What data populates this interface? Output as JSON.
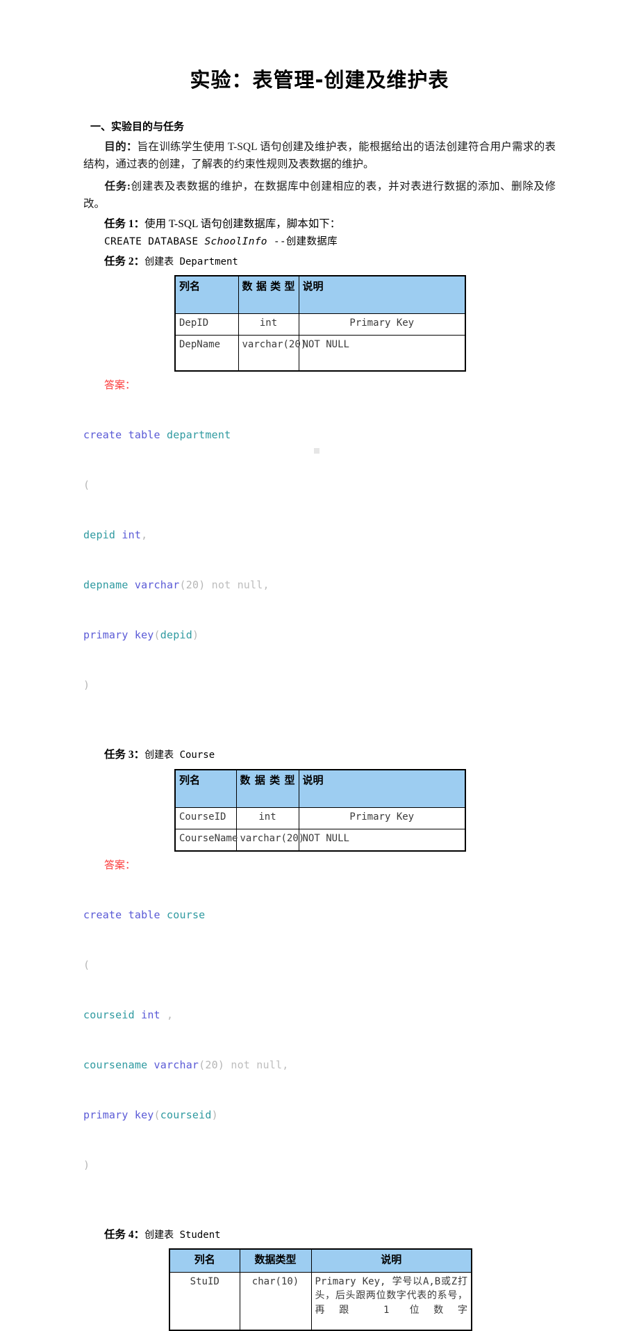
{
  "document": {
    "title": "实验：表管理-创建及维护表",
    "section_heading": "一、实验目的与任务",
    "purpose": {
      "label": "目的：",
      "text": "旨在训练学生使用 T-SQL 语句创建及维护表，能根据给出的语法创建符合用户需求的表结构，通过表的创建，了解表的约束性规则及表数据的维护。"
    },
    "task_intro": {
      "label": "任务:",
      "text": "创建表及表数据的维护，在数据库中创建相应的表，并对表进行数据的添加、删除及修改。"
    },
    "tasks": [
      {
        "label": "任务 1：",
        "text": "使用 T-SQL 语句创建数据库，脚本如下："
      },
      {
        "label": "任务 2：",
        "text": "创建表 Department"
      },
      {
        "label": "任务 3：",
        "text": "创建表 Course"
      },
      {
        "label": "任务 4：",
        "text": "创建表 Student"
      }
    ],
    "create_database_script": {
      "prefix": "CREATE  DATABASE  ",
      "dbname": "SchoolInfo",
      "comment": "  --创建数据库"
    },
    "answer_label": "答案："
  },
  "tables": {
    "department": {
      "headers": [
        "列名",
        "数据类型",
        "说明"
      ],
      "rows": [
        [
          "DepID",
          "int",
          "Primary Key"
        ],
        [
          "DepName",
          "varchar(20)",
          "NOT NULL"
        ]
      ]
    },
    "course": {
      "headers": [
        "列名",
        "数据类型",
        "说明"
      ],
      "rows": [
        [
          "CourseID",
          "int",
          "Primary Key"
        ],
        [
          "CourseName",
          "varchar(20)",
          "NOT NULL"
        ]
      ]
    },
    "student": {
      "headers": [
        "列名",
        "数据类型",
        "说明"
      ],
      "rows": [
        [
          "StuID",
          "char(10)",
          "Primary Key, 学号以A,B或Z打头，后头跟两位数字代表的系号，再跟 1 位数字"
        ]
      ]
    }
  },
  "code_blocks": {
    "department": {
      "lines": [
        "create table department",
        "(",
        "depid int,",
        "depname varchar(20) not null,",
        "primary key(depid)",
        ")"
      ]
    },
    "course": {
      "lines": [
        "create table course",
        "(",
        "courseid int ,",
        "coursename varchar(20) not null,",
        "primary key(courseid)",
        ")"
      ]
    }
  },
  "colors": {
    "table_header_fill": "#9dcdf1",
    "answer_red": "#fb3b3b",
    "code_keyword": "#5a5ad6",
    "code_identifier": "#2f9aa0",
    "code_dim": "#bdbdbd",
    "page_background": "#ffffff",
    "border": "#000000"
  }
}
